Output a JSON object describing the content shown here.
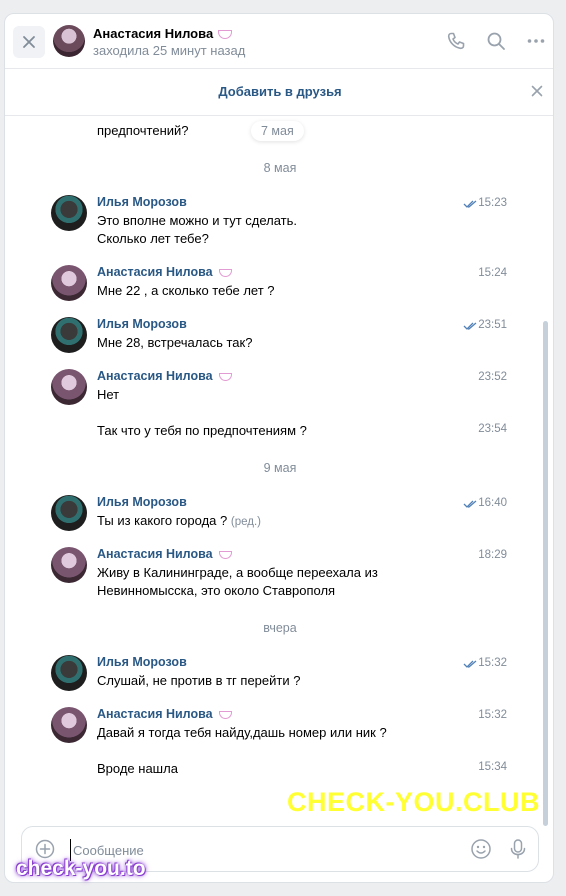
{
  "header": {
    "contact_name": "Анастасия Нилова",
    "status": "заходила 25 минут назад"
  },
  "add_friend": {
    "label": "Добавить в друзья"
  },
  "history": {
    "partial_text": "предпочтений?",
    "floating_date": "7 мая",
    "date_sep_1": "8 мая",
    "date_sep_2": "9 мая",
    "date_sep_3": "вчера",
    "messages": [
      {
        "author": "Илья Морозов",
        "time": "15:23",
        "lines": [
          "Это вполне можно и тут сделать.",
          "Сколько лет тебе?"
        ],
        "read": true
      },
      {
        "author": "Анастасия Нилова",
        "time": "15:24",
        "lines": [
          "Мне 22 , а сколько тебе лет ?"
        ]
      },
      {
        "author": "Илья Морозов",
        "time": "23:51",
        "lines": [
          "Мне 28, встречалась так?"
        ],
        "read": true
      },
      {
        "author": "Анастасия Нилова",
        "time": "23:52",
        "lines": [
          "Нет"
        ],
        "extra": {
          "time": "23:54",
          "text": "Так что у тебя по предпочтениям ?"
        }
      },
      {
        "author": "Илья Морозов",
        "time": "16:40",
        "lines": [
          "Ты из какого города ?"
        ],
        "edited": "(ред.)",
        "read": true
      },
      {
        "author": "Анастасия Нилова",
        "time": "18:29",
        "lines": [
          "Живу в Калининграде, а вообще переехала из",
          "Невинномысска, это около Ставрополя"
        ]
      },
      {
        "author": "Илья Морозов",
        "time": "15:32",
        "lines": [
          "Слушай, не против в тг перейти ?"
        ],
        "read": true
      },
      {
        "author": "Анастасия Нилова",
        "time": "15:32",
        "lines": [
          "Давай я тогда тебя найду,дашь номер или ник ?"
        ],
        "extra": {
          "time": "15:34",
          "text": "Вроде нашла"
        }
      }
    ]
  },
  "composer": {
    "placeholder": "Сообщение"
  },
  "watermarks": {
    "big": "CHECK-YOU.CLUB",
    "small": "check-you.to"
  },
  "colors": {
    "link": "#2a5885",
    "muted": "#818c99",
    "accent_watermark": "#ffff33"
  }
}
